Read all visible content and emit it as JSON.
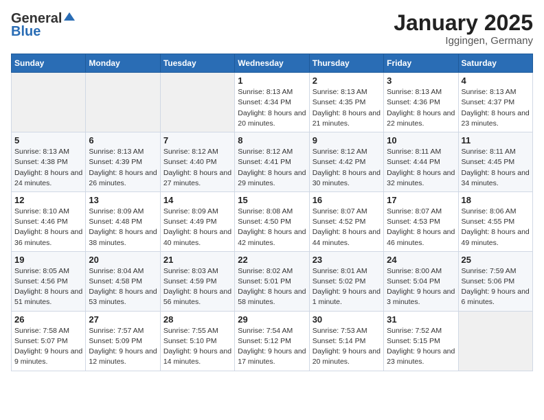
{
  "logo": {
    "general": "General",
    "blue": "Blue"
  },
  "title": "January 2025",
  "subtitle": "Iggingen, Germany",
  "header_days": [
    "Sunday",
    "Monday",
    "Tuesday",
    "Wednesday",
    "Thursday",
    "Friday",
    "Saturday"
  ],
  "weeks": [
    [
      {
        "day": "",
        "empty": true
      },
      {
        "day": "",
        "empty": true
      },
      {
        "day": "",
        "empty": true
      },
      {
        "day": "1",
        "sunrise": "8:13 AM",
        "sunset": "4:34 PM",
        "daylight": "8 hours and 20 minutes."
      },
      {
        "day": "2",
        "sunrise": "8:13 AM",
        "sunset": "4:35 PM",
        "daylight": "8 hours and 21 minutes."
      },
      {
        "day": "3",
        "sunrise": "8:13 AM",
        "sunset": "4:36 PM",
        "daylight": "8 hours and 22 minutes."
      },
      {
        "day": "4",
        "sunrise": "8:13 AM",
        "sunset": "4:37 PM",
        "daylight": "8 hours and 23 minutes."
      }
    ],
    [
      {
        "day": "5",
        "sunrise": "8:13 AM",
        "sunset": "4:38 PM",
        "daylight": "8 hours and 24 minutes."
      },
      {
        "day": "6",
        "sunrise": "8:13 AM",
        "sunset": "4:39 PM",
        "daylight": "8 hours and 26 minutes."
      },
      {
        "day": "7",
        "sunrise": "8:12 AM",
        "sunset": "4:40 PM",
        "daylight": "8 hours and 27 minutes."
      },
      {
        "day": "8",
        "sunrise": "8:12 AM",
        "sunset": "4:41 PM",
        "daylight": "8 hours and 29 minutes."
      },
      {
        "day": "9",
        "sunrise": "8:12 AM",
        "sunset": "4:42 PM",
        "daylight": "8 hours and 30 minutes."
      },
      {
        "day": "10",
        "sunrise": "8:11 AM",
        "sunset": "4:44 PM",
        "daylight": "8 hours and 32 minutes."
      },
      {
        "day": "11",
        "sunrise": "8:11 AM",
        "sunset": "4:45 PM",
        "daylight": "8 hours and 34 minutes."
      }
    ],
    [
      {
        "day": "12",
        "sunrise": "8:10 AM",
        "sunset": "4:46 PM",
        "daylight": "8 hours and 36 minutes."
      },
      {
        "day": "13",
        "sunrise": "8:09 AM",
        "sunset": "4:48 PM",
        "daylight": "8 hours and 38 minutes."
      },
      {
        "day": "14",
        "sunrise": "8:09 AM",
        "sunset": "4:49 PM",
        "daylight": "8 hours and 40 minutes."
      },
      {
        "day": "15",
        "sunrise": "8:08 AM",
        "sunset": "4:50 PM",
        "daylight": "8 hours and 42 minutes."
      },
      {
        "day": "16",
        "sunrise": "8:07 AM",
        "sunset": "4:52 PM",
        "daylight": "8 hours and 44 minutes."
      },
      {
        "day": "17",
        "sunrise": "8:07 AM",
        "sunset": "4:53 PM",
        "daylight": "8 hours and 46 minutes."
      },
      {
        "day": "18",
        "sunrise": "8:06 AM",
        "sunset": "4:55 PM",
        "daylight": "8 hours and 49 minutes."
      }
    ],
    [
      {
        "day": "19",
        "sunrise": "8:05 AM",
        "sunset": "4:56 PM",
        "daylight": "8 hours and 51 minutes."
      },
      {
        "day": "20",
        "sunrise": "8:04 AM",
        "sunset": "4:58 PM",
        "daylight": "8 hours and 53 minutes."
      },
      {
        "day": "21",
        "sunrise": "8:03 AM",
        "sunset": "4:59 PM",
        "daylight": "8 hours and 56 minutes."
      },
      {
        "day": "22",
        "sunrise": "8:02 AM",
        "sunset": "5:01 PM",
        "daylight": "8 hours and 58 minutes."
      },
      {
        "day": "23",
        "sunrise": "8:01 AM",
        "sunset": "5:02 PM",
        "daylight": "9 hours and 1 minute."
      },
      {
        "day": "24",
        "sunrise": "8:00 AM",
        "sunset": "5:04 PM",
        "daylight": "9 hours and 3 minutes."
      },
      {
        "day": "25",
        "sunrise": "7:59 AM",
        "sunset": "5:06 PM",
        "daylight": "9 hours and 6 minutes."
      }
    ],
    [
      {
        "day": "26",
        "sunrise": "7:58 AM",
        "sunset": "5:07 PM",
        "daylight": "9 hours and 9 minutes."
      },
      {
        "day": "27",
        "sunrise": "7:57 AM",
        "sunset": "5:09 PM",
        "daylight": "9 hours and 12 minutes."
      },
      {
        "day": "28",
        "sunrise": "7:55 AM",
        "sunset": "5:10 PM",
        "daylight": "9 hours and 14 minutes."
      },
      {
        "day": "29",
        "sunrise": "7:54 AM",
        "sunset": "5:12 PM",
        "daylight": "9 hours and 17 minutes."
      },
      {
        "day": "30",
        "sunrise": "7:53 AM",
        "sunset": "5:14 PM",
        "daylight": "9 hours and 20 minutes."
      },
      {
        "day": "31",
        "sunrise": "7:52 AM",
        "sunset": "5:15 PM",
        "daylight": "9 hours and 23 minutes."
      },
      {
        "day": "",
        "empty": true
      }
    ]
  ]
}
